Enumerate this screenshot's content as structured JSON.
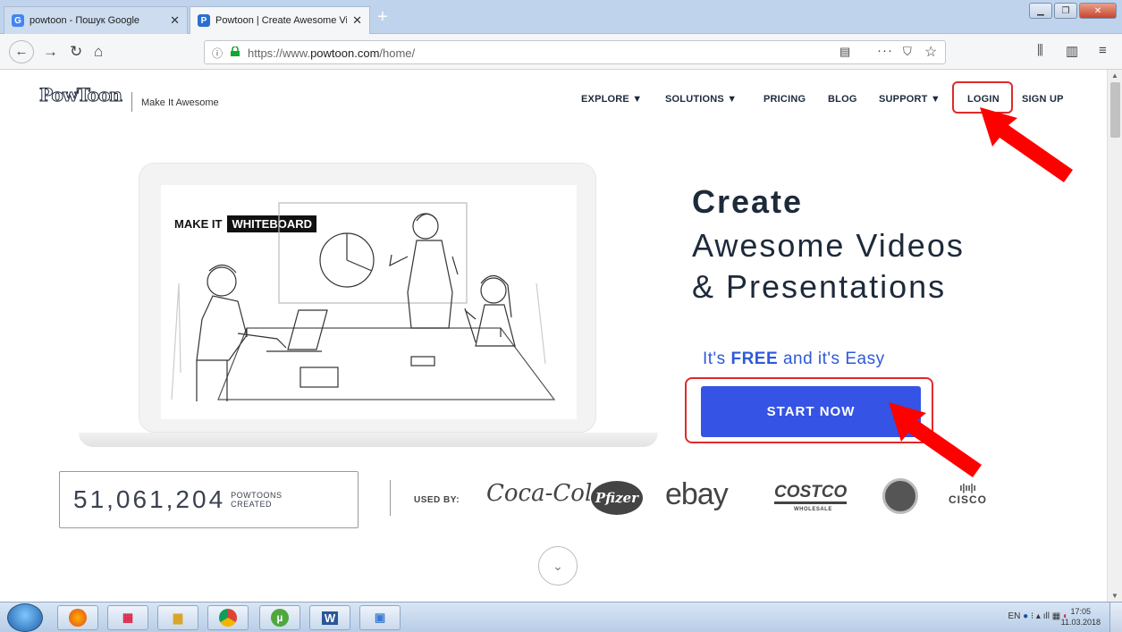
{
  "browser": {
    "tabs": [
      {
        "title": "powtoon - Пошук Google",
        "favicon": "G"
      },
      {
        "title": "Powtoon | Create Awesome Vic",
        "favicon": "P"
      }
    ],
    "url_prefix": "https://www.",
    "url_domain": "powtoon.com",
    "url_path": "/home/"
  },
  "site": {
    "logo": "PowToon",
    "tagline": "Make It Awesome",
    "menu": [
      {
        "label": "EXPLORE ▼"
      },
      {
        "label": "SOLUTIONS ▼"
      },
      {
        "label": "PRICING"
      },
      {
        "label": "BLOG"
      },
      {
        "label": "SUPPORT ▼"
      },
      {
        "label": "LOGIN"
      },
      {
        "label": "SIGN UP"
      }
    ]
  },
  "hero": {
    "illustration_badge_prefix": "MAKE IT",
    "illustration_badge_word": "WHITEBOARD",
    "headline_bold": "Create",
    "headline_line2": "Awesome Videos",
    "headline_line3": "& Presentations",
    "free_prefix": "It's",
    "free_bold": "FREE",
    "free_suffix": "and it's Easy",
    "cta": "START NOW"
  },
  "stats": {
    "count": "51,061,204",
    "count_label_line1": "POWTOONS",
    "count_label_line2": "CREATED",
    "used_by": "USED BY:",
    "brands": [
      "Coca-Cola",
      "Pfizer",
      "ebay",
      "COSTCO",
      "WHOLESALE",
      "Starbucks",
      "CISCO"
    ]
  },
  "taskbar": {
    "lang": "EN",
    "time": "17:05",
    "date": "11.03.2018",
    "word_icon": "W"
  },
  "colors": {
    "accent_blue": "#3553e5",
    "free_blue": "#2e59d9",
    "annotation_red": "#e02a2a",
    "navy": "#1d2a3a"
  }
}
